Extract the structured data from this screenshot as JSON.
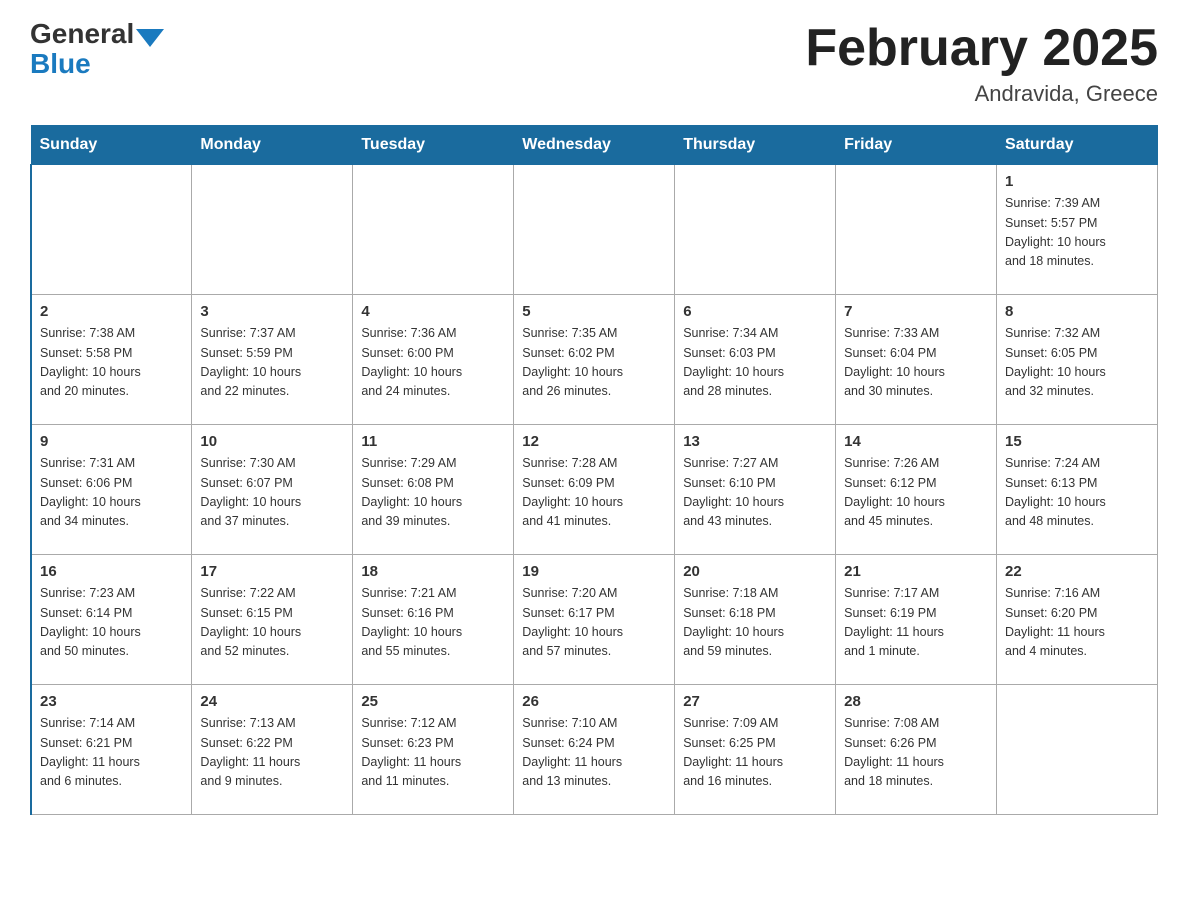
{
  "header": {
    "logo_general": "General",
    "logo_blue": "Blue",
    "title": "February 2025",
    "subtitle": "Andravida, Greece"
  },
  "weekdays": [
    "Sunday",
    "Monday",
    "Tuesday",
    "Wednesday",
    "Thursday",
    "Friday",
    "Saturday"
  ],
  "weeks": [
    [
      {
        "day": "",
        "info": ""
      },
      {
        "day": "",
        "info": ""
      },
      {
        "day": "",
        "info": ""
      },
      {
        "day": "",
        "info": ""
      },
      {
        "day": "",
        "info": ""
      },
      {
        "day": "",
        "info": ""
      },
      {
        "day": "1",
        "info": "Sunrise: 7:39 AM\nSunset: 5:57 PM\nDaylight: 10 hours\nand 18 minutes."
      }
    ],
    [
      {
        "day": "2",
        "info": "Sunrise: 7:38 AM\nSunset: 5:58 PM\nDaylight: 10 hours\nand 20 minutes."
      },
      {
        "day": "3",
        "info": "Sunrise: 7:37 AM\nSunset: 5:59 PM\nDaylight: 10 hours\nand 22 minutes."
      },
      {
        "day": "4",
        "info": "Sunrise: 7:36 AM\nSunset: 6:00 PM\nDaylight: 10 hours\nand 24 minutes."
      },
      {
        "day": "5",
        "info": "Sunrise: 7:35 AM\nSunset: 6:02 PM\nDaylight: 10 hours\nand 26 minutes."
      },
      {
        "day": "6",
        "info": "Sunrise: 7:34 AM\nSunset: 6:03 PM\nDaylight: 10 hours\nand 28 minutes."
      },
      {
        "day": "7",
        "info": "Sunrise: 7:33 AM\nSunset: 6:04 PM\nDaylight: 10 hours\nand 30 minutes."
      },
      {
        "day": "8",
        "info": "Sunrise: 7:32 AM\nSunset: 6:05 PM\nDaylight: 10 hours\nand 32 minutes."
      }
    ],
    [
      {
        "day": "9",
        "info": "Sunrise: 7:31 AM\nSunset: 6:06 PM\nDaylight: 10 hours\nand 34 minutes."
      },
      {
        "day": "10",
        "info": "Sunrise: 7:30 AM\nSunset: 6:07 PM\nDaylight: 10 hours\nand 37 minutes."
      },
      {
        "day": "11",
        "info": "Sunrise: 7:29 AM\nSunset: 6:08 PM\nDaylight: 10 hours\nand 39 minutes."
      },
      {
        "day": "12",
        "info": "Sunrise: 7:28 AM\nSunset: 6:09 PM\nDaylight: 10 hours\nand 41 minutes."
      },
      {
        "day": "13",
        "info": "Sunrise: 7:27 AM\nSunset: 6:10 PM\nDaylight: 10 hours\nand 43 minutes."
      },
      {
        "day": "14",
        "info": "Sunrise: 7:26 AM\nSunset: 6:12 PM\nDaylight: 10 hours\nand 45 minutes."
      },
      {
        "day": "15",
        "info": "Sunrise: 7:24 AM\nSunset: 6:13 PM\nDaylight: 10 hours\nand 48 minutes."
      }
    ],
    [
      {
        "day": "16",
        "info": "Sunrise: 7:23 AM\nSunset: 6:14 PM\nDaylight: 10 hours\nand 50 minutes."
      },
      {
        "day": "17",
        "info": "Sunrise: 7:22 AM\nSunset: 6:15 PM\nDaylight: 10 hours\nand 52 minutes."
      },
      {
        "day": "18",
        "info": "Sunrise: 7:21 AM\nSunset: 6:16 PM\nDaylight: 10 hours\nand 55 minutes."
      },
      {
        "day": "19",
        "info": "Sunrise: 7:20 AM\nSunset: 6:17 PM\nDaylight: 10 hours\nand 57 minutes."
      },
      {
        "day": "20",
        "info": "Sunrise: 7:18 AM\nSunset: 6:18 PM\nDaylight: 10 hours\nand 59 minutes."
      },
      {
        "day": "21",
        "info": "Sunrise: 7:17 AM\nSunset: 6:19 PM\nDaylight: 11 hours\nand 1 minute."
      },
      {
        "day": "22",
        "info": "Sunrise: 7:16 AM\nSunset: 6:20 PM\nDaylight: 11 hours\nand 4 minutes."
      }
    ],
    [
      {
        "day": "23",
        "info": "Sunrise: 7:14 AM\nSunset: 6:21 PM\nDaylight: 11 hours\nand 6 minutes."
      },
      {
        "day": "24",
        "info": "Sunrise: 7:13 AM\nSunset: 6:22 PM\nDaylight: 11 hours\nand 9 minutes."
      },
      {
        "day": "25",
        "info": "Sunrise: 7:12 AM\nSunset: 6:23 PM\nDaylight: 11 hours\nand 11 minutes."
      },
      {
        "day": "26",
        "info": "Sunrise: 7:10 AM\nSunset: 6:24 PM\nDaylight: 11 hours\nand 13 minutes."
      },
      {
        "day": "27",
        "info": "Sunrise: 7:09 AM\nSunset: 6:25 PM\nDaylight: 11 hours\nand 16 minutes."
      },
      {
        "day": "28",
        "info": "Sunrise: 7:08 AM\nSunset: 6:26 PM\nDaylight: 11 hours\nand 18 minutes."
      },
      {
        "day": "",
        "info": ""
      }
    ]
  ]
}
